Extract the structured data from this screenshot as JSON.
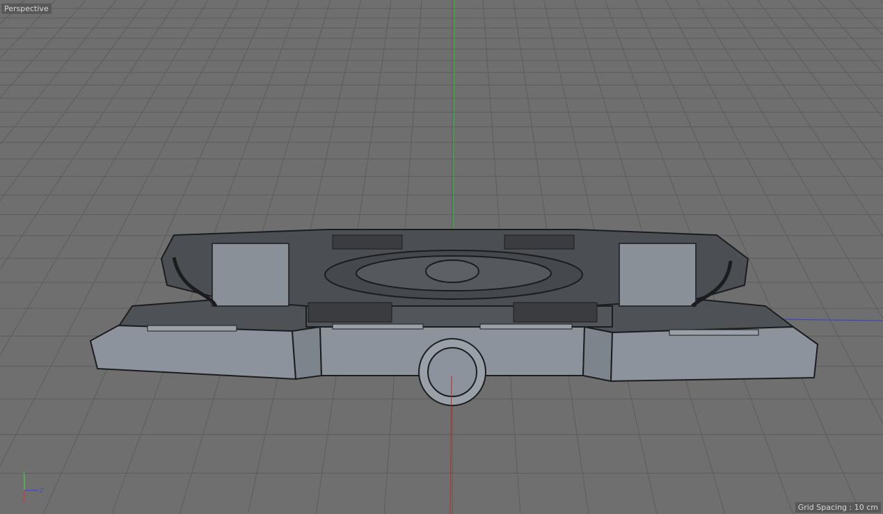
{
  "viewport": {
    "camera_label": "Perspective",
    "grid_spacing_label": "Grid Spacing : 10 cm",
    "axis_gizmo": {
      "y": "Y",
      "z": "Z",
      "x": "X"
    }
  },
  "colors": {
    "background": "#6f6f6f",
    "grid_line": "#5c5c5c",
    "y_axis": "#2fbf2f",
    "x_axis": "#c02828",
    "z_axis": "#3a3ad0",
    "model_top": "#4b4e53",
    "model_side": "#8d939c",
    "model_edge": "#1b1c1e"
  }
}
